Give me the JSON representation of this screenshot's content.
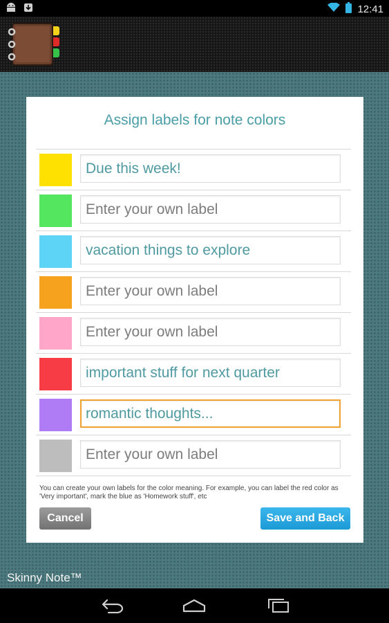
{
  "status_bar": {
    "time": "12:41",
    "icons": [
      "android-icon",
      "download-icon",
      "wifi-icon",
      "battery-icon"
    ]
  },
  "app": {
    "logo_icon": "notebook-logo-icon",
    "brand": "Skinny Note™"
  },
  "dialog": {
    "title": "Assign labels for note colors",
    "rows": [
      {
        "color": "#ffe100",
        "value": "Due this week!",
        "placeholder": "Enter your own label"
      },
      {
        "color": "#55e660",
        "value": "",
        "placeholder": "Enter your own label"
      },
      {
        "color": "#5dd3f5",
        "value": "vacation things to explore",
        "placeholder": "Enter your own label"
      },
      {
        "color": "#f6a21f",
        "value": "",
        "placeholder": "Enter your own label"
      },
      {
        "color": "#ffa6c9",
        "value": "",
        "placeholder": "Enter your own label"
      },
      {
        "color": "#f83c46",
        "value": "important stuff for next quarter",
        "placeholder": "Enter your own label"
      },
      {
        "color": "#b07cf6",
        "value": "romantic thoughts...",
        "placeholder": "Enter your own label"
      },
      {
        "color": "#bdbdbd",
        "value": "",
        "placeholder": "Enter your own label"
      }
    ],
    "help_text": "You can create your own labels for the color meaning. For example, you can label the red color as 'Very important', mark the blue as 'Homework stuff', etc",
    "cancel_label": "Cancel",
    "save_label": "Save and Back"
  },
  "colors": {
    "accent": "#4a9ea6",
    "focus": "#f0a22e",
    "save_button": "#1c9ad6"
  },
  "nav_bar": {
    "icons": [
      "back-icon",
      "home-icon",
      "recent-apps-icon"
    ]
  }
}
